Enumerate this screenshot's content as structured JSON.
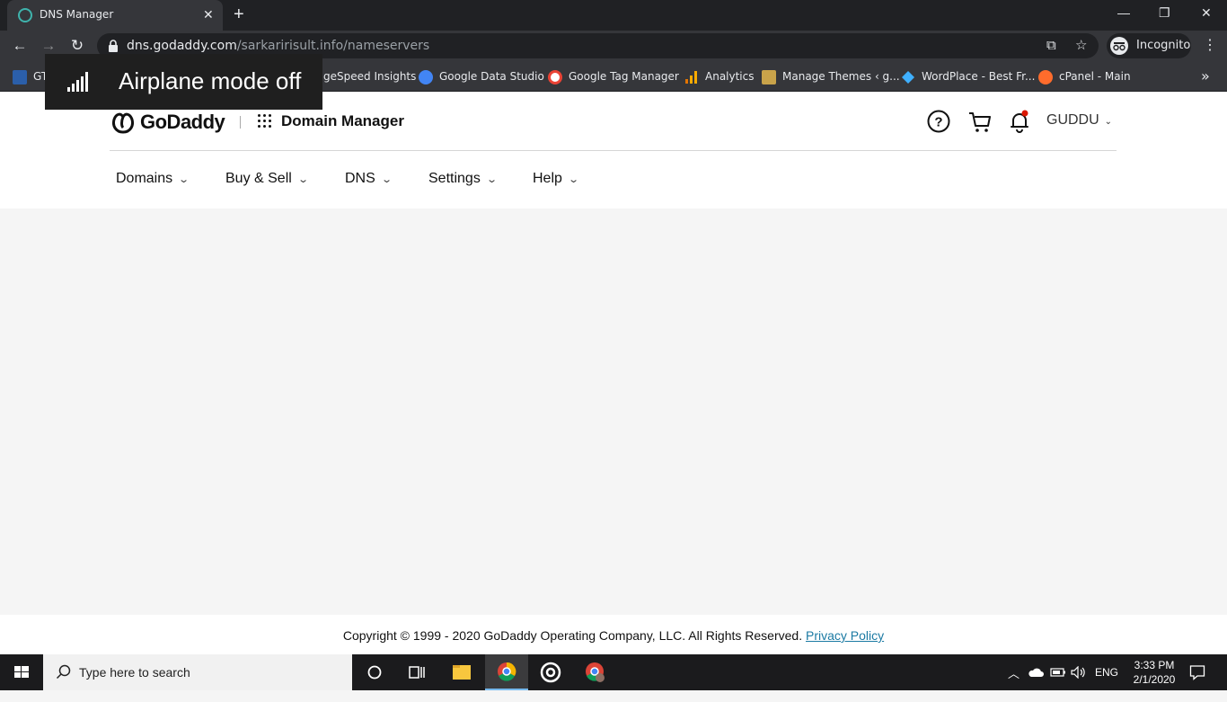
{
  "browser": {
    "tab_title": "DNS Manager",
    "url_host": "dns.godaddy.com",
    "url_path": "/sarkaririsult.info/nameservers",
    "profile_label": "Incognito",
    "bookmarks": [
      {
        "label": "GT",
        "icon": "gtmetrix-icon",
        "color": "#2b5faa"
      },
      {
        "label": "PageSpeed Insights",
        "icon": "pagespeed-icon",
        "color": "#4285f4"
      },
      {
        "label": "Google Data Studio",
        "icon": "data-studio-icon",
        "color": "#4285f4"
      },
      {
        "label": "Google Tag Manager",
        "icon": "google-icon",
        "color": "#ea4335"
      },
      {
        "label": "Analytics",
        "icon": "analytics-icon",
        "color": "#f9ab00"
      },
      {
        "label": "Manage Themes ‹ g...",
        "icon": "avatar-icon",
        "color": "#c9a34a"
      },
      {
        "label": "WordPlace - Best Fr...",
        "icon": "wordplace-icon",
        "color": "#3fb0ff"
      },
      {
        "label": "cPanel - Main",
        "icon": "cpanel-icon",
        "color": "#ff6c2c"
      }
    ],
    "overflow_label": "»"
  },
  "notification": {
    "text": "Airplane mode off"
  },
  "page": {
    "logo_text": "GoDaddy",
    "app_title": "Domain Manager",
    "user_name": "GUDDU",
    "nav": [
      {
        "label": "Domains"
      },
      {
        "label": "Buy & Sell"
      },
      {
        "label": "DNS"
      },
      {
        "label": "Settings"
      },
      {
        "label": "Help"
      }
    ],
    "footer": {
      "copyright": "Copyright © 1999 - 2020 GoDaddy Operating Company, LLC. All Rights Reserved.",
      "privacy_link": "Privacy Policy"
    },
    "colors": {
      "brand": "#111111",
      "link": "#1b7aa3",
      "notification_dot": "#db1802"
    }
  },
  "taskbar": {
    "search_placeholder": "Type here to search",
    "language": "ENG",
    "time": "3:33 PM",
    "date": "2/1/2020"
  }
}
